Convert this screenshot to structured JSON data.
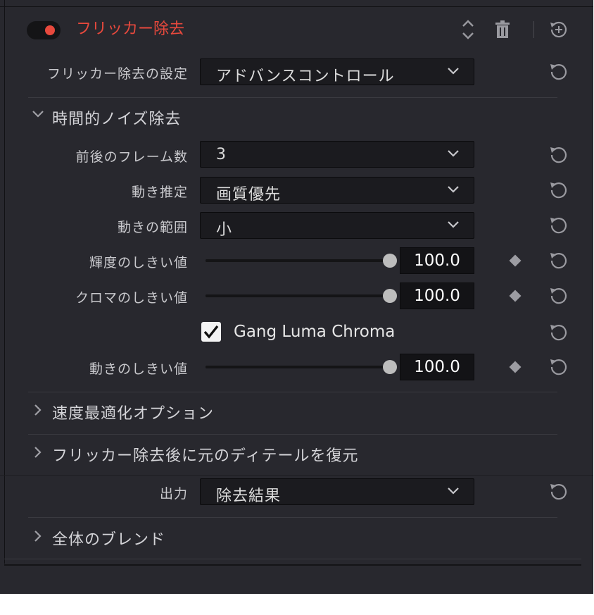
{
  "header": {
    "title": "フリッカー除去",
    "enabled": true,
    "accent_color": "#e8493d",
    "icons": [
      "up-down-arrows-icon",
      "trash-icon",
      "add-circle-icon"
    ]
  },
  "settings_row": {
    "label": "フリッカー除去の設定",
    "value": "アドバンスコントロール"
  },
  "temporal_nr": {
    "title": "時間的ノイズ除去",
    "expanded": true,
    "frames": {
      "label": "前後のフレーム数",
      "value": "3"
    },
    "motion_estimation": {
      "label": "動き推定",
      "value": "画質優先"
    },
    "motion_range": {
      "label": "動きの範囲",
      "value": "小"
    },
    "luma_threshold": {
      "label": "輝度のしきい値",
      "value": "100.0",
      "fraction": 1.0
    },
    "chroma_threshold": {
      "label": "クロマのしきい値",
      "value": "100.0",
      "fraction": 1.0
    },
    "gang_luma_chroma": {
      "label": "Gang Luma Chroma",
      "checked": true
    },
    "motion_threshold": {
      "label": "動きのしきい値",
      "value": "100.0",
      "fraction": 1.0
    }
  },
  "speed_opt": {
    "title": "速度最適化オプション",
    "expanded": false
  },
  "restore_detail": {
    "title": "フリッカー除去後に元のディテールを復元",
    "expanded": false
  },
  "output": {
    "label": "出力",
    "value": "除去結果"
  },
  "global_blend": {
    "title": "全体のブレンド",
    "expanded": false
  }
}
